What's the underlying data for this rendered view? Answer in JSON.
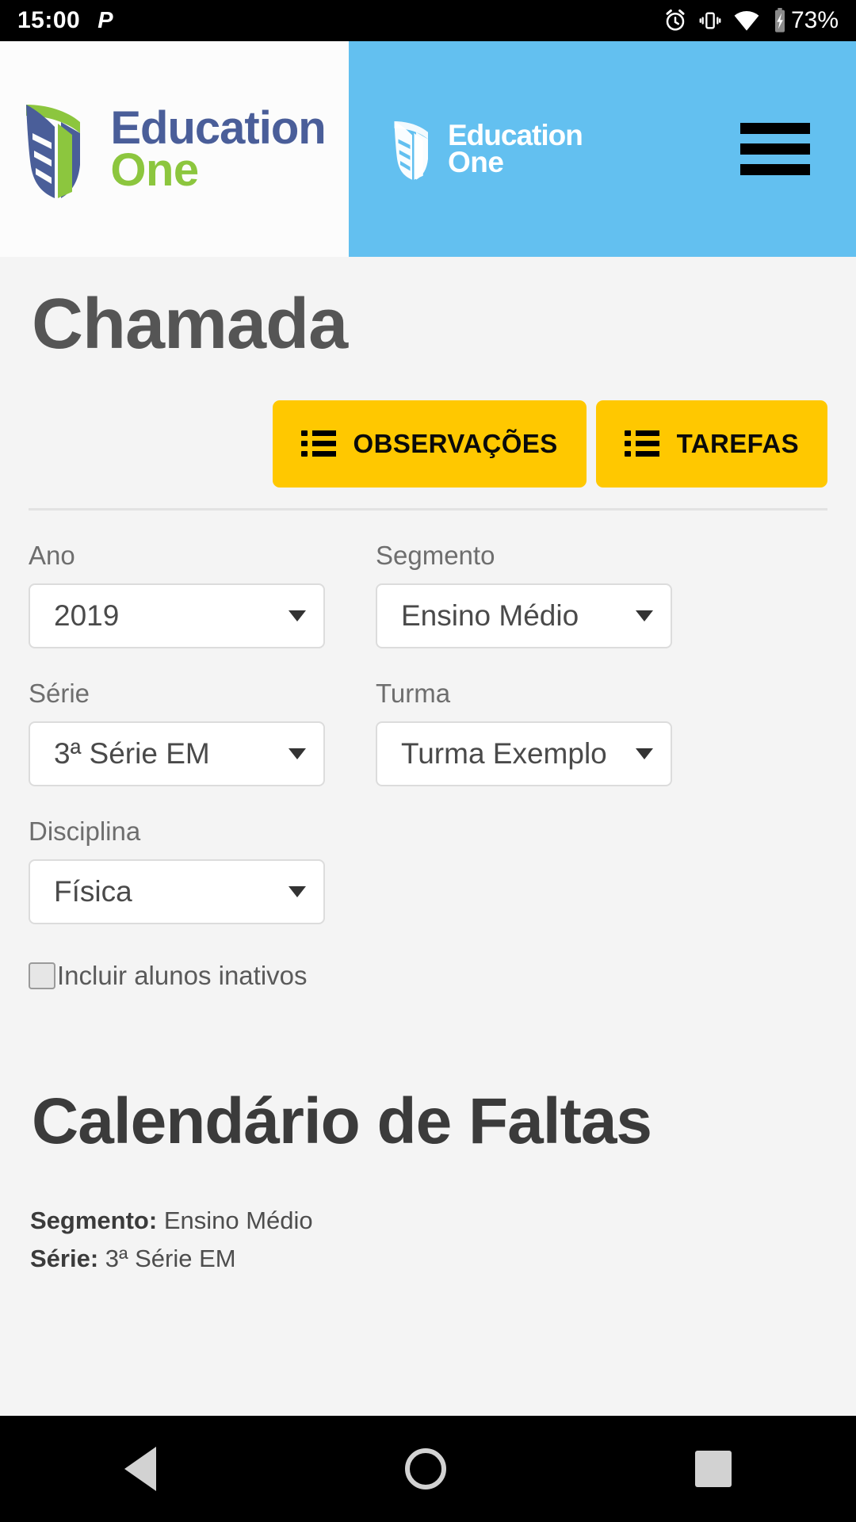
{
  "status_bar": {
    "time": "15:00",
    "app_icon": "P",
    "icons": [
      "alarm-icon",
      "vibrate-icon",
      "wifi-icon",
      "battery-charging-icon"
    ],
    "battery": "73%"
  },
  "header": {
    "logo_line1": "Education",
    "logo_line2": "One",
    "menu_icon": "hamburger-menu-icon",
    "brand_blue": "#63c0f0",
    "brand_navy": "#4a5e99",
    "brand_green": "#8cc63e"
  },
  "page": {
    "title": "Chamada",
    "accent_yellow": "#ffc800"
  },
  "actions": [
    {
      "label": "OBSERVAÇÕES",
      "icon": "list-icon"
    },
    {
      "label": "TAREFAS",
      "icon": "list-icon"
    }
  ],
  "form": {
    "fields": [
      {
        "label": "Ano",
        "value": "2019"
      },
      {
        "label": "Segmento",
        "value": "Ensino Médio"
      },
      {
        "label": "Série",
        "value": "3ª Série EM"
      },
      {
        "label": "Turma",
        "value": "Turma Exemplo"
      },
      {
        "label": "Disciplina",
        "value": "Física"
      }
    ],
    "checkbox": {
      "label": "Incluir alunos inativos",
      "checked": false
    }
  },
  "calendar_section": {
    "title": "Calendário de Faltas",
    "meta": [
      {
        "label": "Segmento:",
        "value": "Ensino Médio"
      },
      {
        "label": "Série:",
        "value": "3ª Série EM"
      }
    ]
  },
  "nav_bar": {
    "back": "back-triangle-icon",
    "home": "home-circle-icon",
    "recent": "recents-square-icon"
  }
}
